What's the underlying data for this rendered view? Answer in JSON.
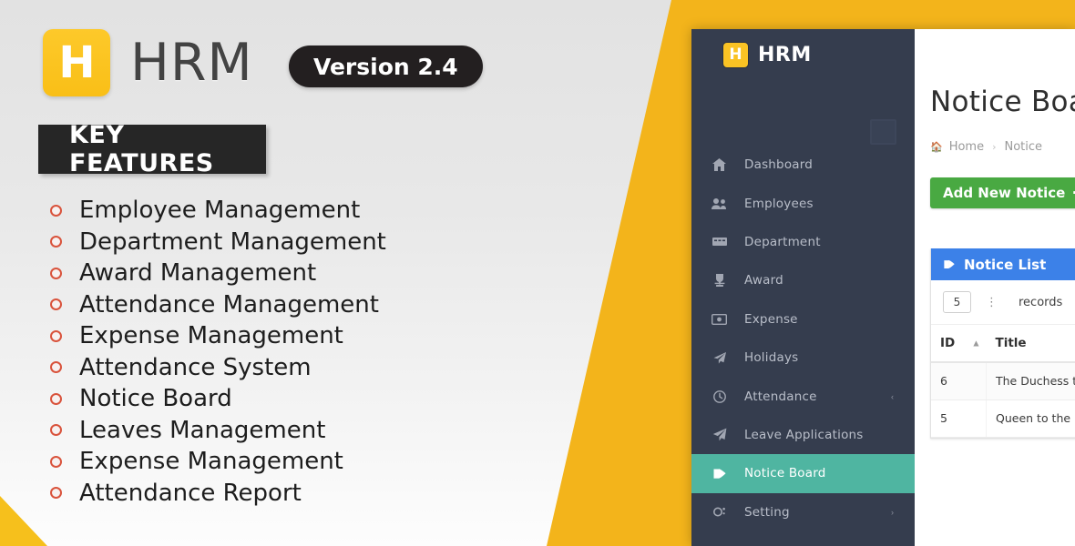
{
  "promo": {
    "brand_name": "HRM",
    "logo_letter": "H",
    "version_badge": "Version 2.4",
    "section_title": "KEY FEATURES",
    "features": [
      {
        "label": "Employee Management"
      },
      {
        "label": "Department Management"
      },
      {
        "label": "Award Management"
      },
      {
        "label": "Attendance Management"
      },
      {
        "label": "Expense Management"
      },
      {
        "label": "Attendance System"
      },
      {
        "label": "Notice Board"
      },
      {
        "label": "Leaves Management"
      },
      {
        "label": "Expense Management"
      },
      {
        "label": "Attendance Report"
      }
    ]
  },
  "app": {
    "brand_name": "HRM",
    "logo_letter": "H",
    "sidebar": {
      "items": [
        {
          "label": "Dashboard",
          "icon": "dashboard-icon",
          "active": false,
          "caret": ""
        },
        {
          "label": "Employees",
          "icon": "users-icon",
          "active": false,
          "caret": ""
        },
        {
          "label": "Department",
          "icon": "building-icon",
          "active": false,
          "caret": ""
        },
        {
          "label": "Award",
          "icon": "trophy-icon",
          "active": false,
          "caret": ""
        },
        {
          "label": "Expense",
          "icon": "money-icon",
          "active": false,
          "caret": ""
        },
        {
          "label": "Holidays",
          "icon": "plane-icon",
          "active": false,
          "caret": ""
        },
        {
          "label": "Attendance",
          "icon": "clock-icon",
          "active": false,
          "caret": "‹"
        },
        {
          "label": "Leave Applications",
          "icon": "send-icon",
          "active": false,
          "caret": ""
        },
        {
          "label": "Notice Board",
          "icon": "notice-icon",
          "active": true,
          "caret": ""
        },
        {
          "label": "Setting",
          "icon": "gear-icon",
          "active": false,
          "caret": "›"
        }
      ]
    },
    "page": {
      "title": "Notice Board",
      "breadcrumb": {
        "home": "Home",
        "separator": "›",
        "current": "Notice"
      },
      "add_button": {
        "label": "Add New Notice",
        "plus": "✚"
      },
      "notice_list": {
        "panel_title": "Notice List",
        "length": {
          "value": "5",
          "label": "records"
        },
        "columns": [
          {
            "label": "ID"
          },
          {
            "label": "Title"
          }
        ],
        "rows": [
          {
            "id": "6",
            "title": "The Duchess took no notice."
          },
          {
            "id": "5",
            "title": "Queen to the next on."
          }
        ]
      }
    }
  },
  "colors": {
    "brand_yellow": "#f9bf17",
    "accent_green": "#4fb5a1",
    "button_green": "#49a942",
    "panel_blue": "#3c81e8",
    "sidebar_dark": "#353d4e",
    "bullet_red": "#d9533c",
    "badge_black": "#231f20"
  }
}
